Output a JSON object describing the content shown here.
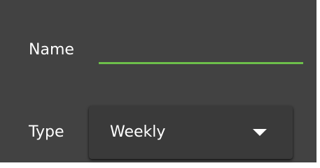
{
  "form": {
    "name": {
      "label": "Name",
      "value": "",
      "accent_color": "#6dbf4b"
    },
    "type": {
      "label": "Type",
      "selected": "Weekly",
      "icon": "caret-down-icon"
    }
  },
  "theme": {
    "panel_background": "#424242",
    "text_color": "#ffffff"
  }
}
